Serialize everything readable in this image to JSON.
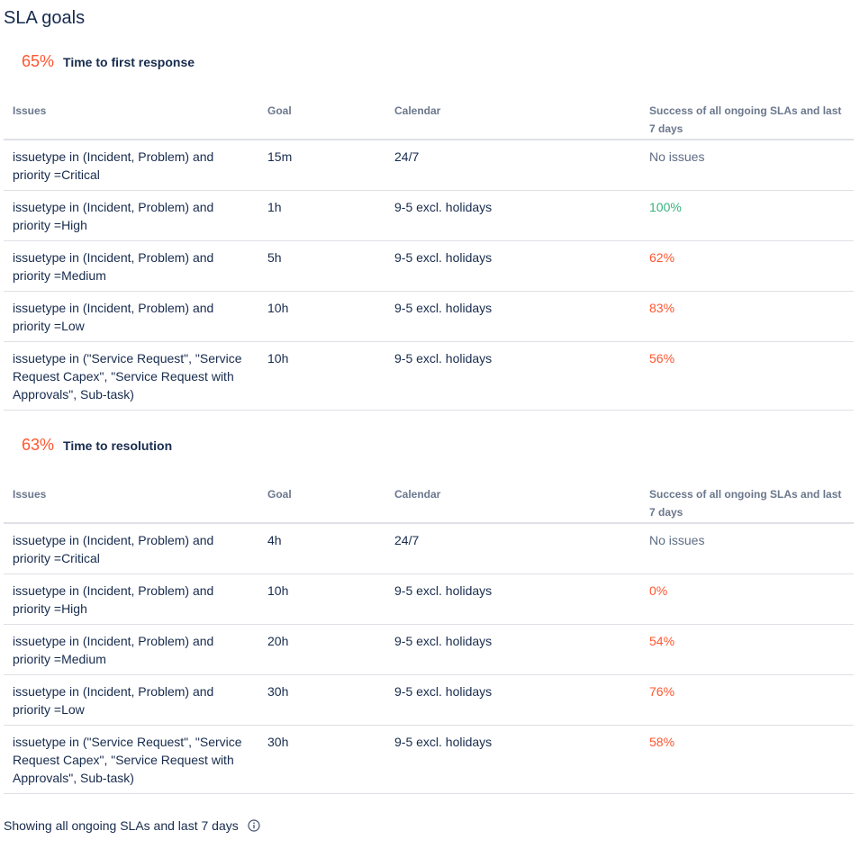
{
  "page_title": "SLA goals",
  "columns": {
    "issues": "Issues",
    "goal": "Goal",
    "calendar": "Calendar",
    "success": "Success of all ongoing SLAs and last 7 days"
  },
  "sections": [
    {
      "percent": "65%",
      "name": "Time to first response",
      "rows": [
        {
          "issues": "issuetype in (Incident, Problem) and priority =Critical",
          "goal": "15m",
          "calendar": "24/7",
          "success": "No issues",
          "status": "none"
        },
        {
          "issues": "issuetype in (Incident, Problem) and priority =High",
          "goal": "1h",
          "calendar": "9-5 excl. holidays",
          "success": "100%",
          "status": "good"
        },
        {
          "issues": "issuetype in (Incident, Problem) and priority =Medium",
          "goal": "5h",
          "calendar": "9-5 excl. holidays",
          "success": "62%",
          "status": "bad"
        },
        {
          "issues": "issuetype in (Incident, Problem) and priority =Low",
          "goal": "10h",
          "calendar": "9-5 excl. holidays",
          "success": "83%",
          "status": "bad"
        },
        {
          "issues": "issuetype in (\"Service Request\", \"Service Request Capex\", \"Service Request with Approvals\", Sub-task)",
          "goal": "10h",
          "calendar": "9-5 excl. holidays",
          "success": "56%",
          "status": "bad"
        }
      ]
    },
    {
      "percent": "63%",
      "name": "Time to resolution",
      "rows": [
        {
          "issues": "issuetype in (Incident, Problem) and priority =Critical",
          "goal": "4h",
          "calendar": "24/7",
          "success": "No issues",
          "status": "none"
        },
        {
          "issues": "issuetype in (Incident, Problem) and priority =High",
          "goal": "10h",
          "calendar": "9-5 excl. holidays",
          "success": "0%",
          "status": "bad"
        },
        {
          "issues": "issuetype in (Incident, Problem) and priority =Medium",
          "goal": "20h",
          "calendar": "9-5 excl. holidays",
          "success": "54%",
          "status": "bad"
        },
        {
          "issues": "issuetype in (Incident, Problem) and priority =Low",
          "goal": "30h",
          "calendar": "9-5 excl. holidays",
          "success": "76%",
          "status": "bad"
        },
        {
          "issues": "issuetype in (\"Service Request\", \"Service Request Capex\", \"Service Request with Approvals\", Sub-task)",
          "goal": "30h",
          "calendar": "9-5 excl. holidays",
          "success": "58%",
          "status": "bad"
        }
      ]
    }
  ],
  "footer": {
    "text": "Showing all ongoing SLAs and last 7 days",
    "icon": "info-icon"
  },
  "colors": {
    "good": "#36b37e",
    "bad": "#ff5630",
    "neutral": "#5e6c84"
  }
}
